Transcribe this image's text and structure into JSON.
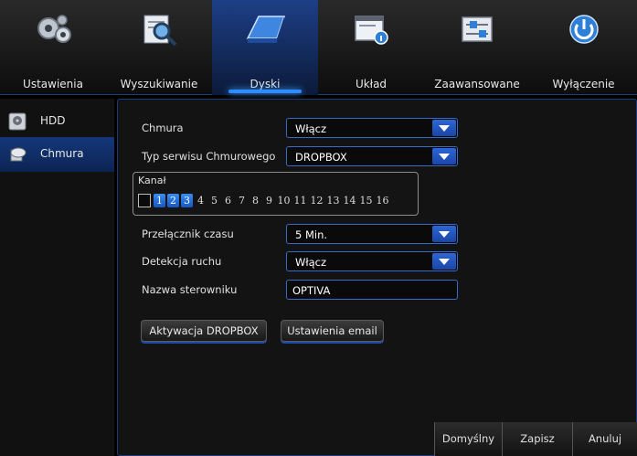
{
  "top_tabs": [
    {
      "label": "Ustawienia",
      "icon": "gears-icon"
    },
    {
      "label": "Wyszukiwanie",
      "icon": "magnifier-icon"
    },
    {
      "label": "Dyski",
      "icon": "disk-icon"
    },
    {
      "label": "Układ",
      "icon": "info-window-icon"
    },
    {
      "label": "Zaawansowane",
      "icon": "sliders-icon"
    },
    {
      "label": "Wyłączenie",
      "icon": "power-icon"
    }
  ],
  "active_tab": "Dyski",
  "sidebar": {
    "items": [
      {
        "label": "HDD",
        "icon": "hdd-icon"
      },
      {
        "label": "Chmura",
        "icon": "cloud-icon"
      }
    ],
    "active": "Chmura"
  },
  "form": {
    "chmura": {
      "label": "Chmura",
      "value": "Włącz"
    },
    "typ": {
      "label": "Typ serwisu Chmurowego",
      "value": "DROPBOX"
    },
    "kanal": {
      "label": "Kanał",
      "channels": [
        "1",
        "2",
        "3",
        "4",
        "5",
        "6",
        "7",
        "8",
        "9",
        "10",
        "11",
        "12",
        "13",
        "14",
        "15",
        "16"
      ],
      "selected": [
        "1",
        "2",
        "3"
      ]
    },
    "przelacznik": {
      "label": "Przełącznik czasu",
      "value": "5 Min."
    },
    "detekcja": {
      "label": "Detekcja ruchu",
      "value": "Włącz"
    },
    "nazwa": {
      "label": "Nazwa sterowniku",
      "value": "OPTIVA"
    }
  },
  "buttons": {
    "aktywacja": "Aktywacja DROPBOX",
    "email": "Ustawienia email",
    "domyslny": "Domyślny",
    "zapisz": "Zapisz",
    "anuluj": "Anuluj"
  },
  "colors": {
    "accent": "#2e8cff",
    "panel_border": "#1c3a7a",
    "background": "#000000"
  }
}
